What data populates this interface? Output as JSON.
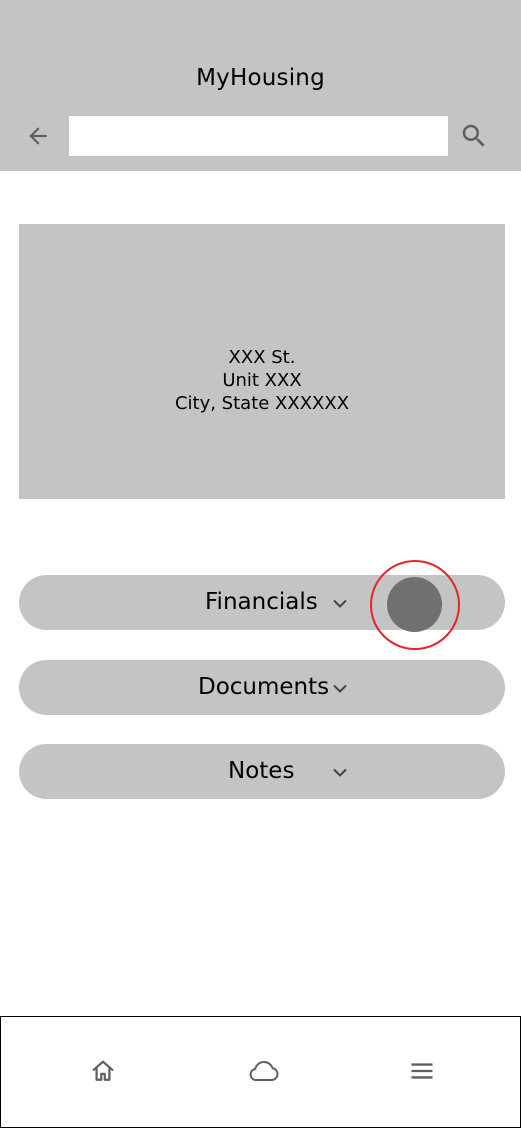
{
  "header": {
    "title": "MyHousing",
    "search_placeholder": "",
    "search_value": "",
    "icons": {
      "back": "arrow-left-icon",
      "search": "search-icon"
    }
  },
  "address": {
    "line1": "XXX St.",
    "line2": "Unit XXX",
    "line3": "City, State XXXXXX"
  },
  "sections": [
    {
      "label": "Financials",
      "icon": "chevron-down-icon"
    },
    {
      "label": "Documents",
      "icon": "chevron-down-icon"
    },
    {
      "label": "Notes",
      "icon": "chevron-down-icon"
    }
  ],
  "bottom_nav": [
    {
      "icon": "home-icon"
    },
    {
      "icon": "cloud-icon"
    },
    {
      "icon": "menu-icon"
    }
  ],
  "colors": {
    "panel_gray": "#c4c4c4",
    "icon_gray": "#5f5f5f",
    "touch_indicator": "#707070",
    "touch_ring": "#e0262b"
  }
}
